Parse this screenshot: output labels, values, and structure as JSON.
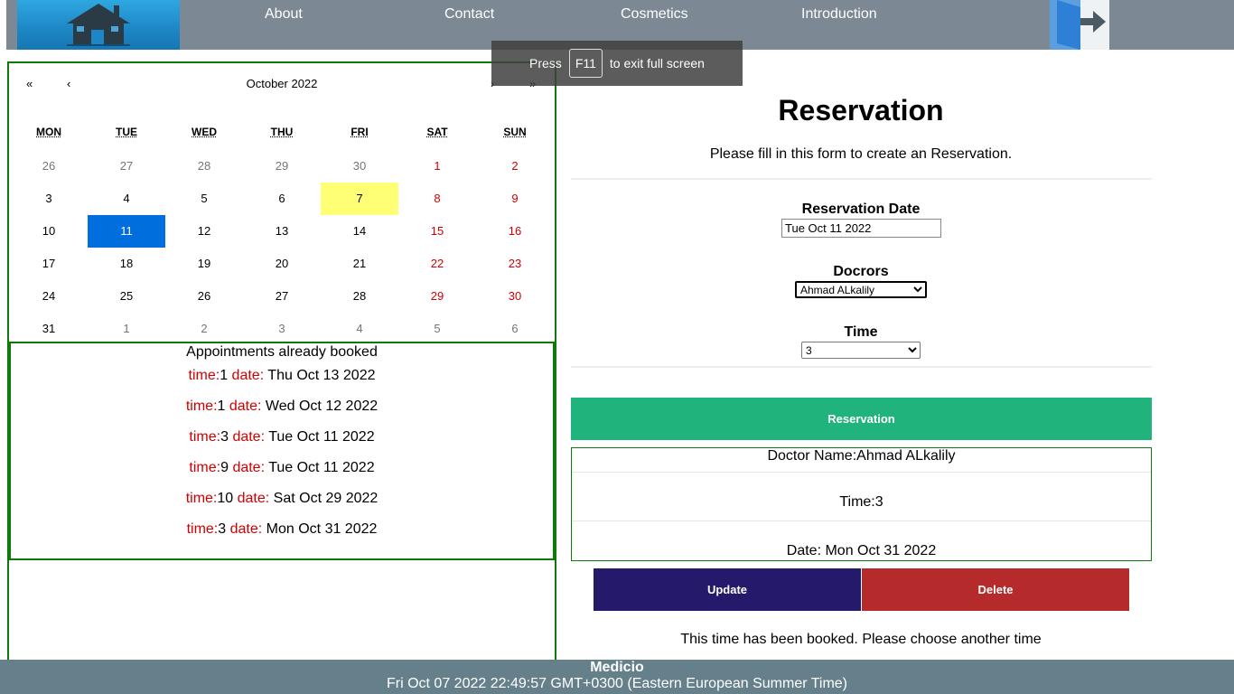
{
  "header": {
    "nav": [
      "About",
      "Contact",
      "Cosmetics",
      "Introduction"
    ]
  },
  "fullscreen_notice": {
    "press": "Press",
    "key": "F11",
    "rest": "to exit full screen"
  },
  "calendar": {
    "title": "October 2022",
    "nav_prev2": "«",
    "nav_prev": "‹",
    "nav_next": "›",
    "nav_next2": "»",
    "weekdays": [
      "MON",
      "TUE",
      "WED",
      "THU",
      "FRI",
      "SAT",
      "SUN"
    ],
    "days": [
      [
        "26",
        "27",
        "28",
        "29",
        "30",
        "1",
        "2"
      ],
      [
        "3",
        "4",
        "5",
        "6",
        "7",
        "8",
        "9"
      ],
      [
        "10",
        "11",
        "12",
        "13",
        "14",
        "15",
        "16"
      ],
      [
        "17",
        "18",
        "19",
        "20",
        "21",
        "22",
        "23"
      ],
      [
        "24",
        "25",
        "26",
        "27",
        "28",
        "29",
        "30"
      ],
      [
        "31",
        "1",
        "2",
        "3",
        "4",
        "5",
        "6"
      ]
    ],
    "today": "7",
    "selected": "11",
    "weekend_color": "#d10000",
    "selected_color": "#006edc",
    "today_color": "#ffff76"
  },
  "booked": {
    "title": "Appointments already booked",
    "time_label": "time:",
    "date_label": "date:",
    "items": [
      {
        "time": "1",
        "date": "Thu Oct 13 2022"
      },
      {
        "time": "1",
        "date": "Wed Oct 12 2022"
      },
      {
        "time": "3",
        "date": "Tue Oct 11 2022"
      },
      {
        "time": "9",
        "date": "Tue Oct 11 2022"
      },
      {
        "time": "10",
        "date": "Sat Oct 29 2022"
      },
      {
        "time": "3",
        "date": "Mon Oct 31 2022"
      }
    ]
  },
  "form": {
    "title": "Reservation",
    "subtitle": "Please fill in this form to create an Reservation.",
    "date_label": "Reservation Date",
    "date_value": "Tue Oct 11 2022",
    "doctors_label": "Docrors",
    "doctor_selected": "Ahmad ALkalily",
    "time_label": "Time",
    "time_selected": "3",
    "reserve_button": "Reservation"
  },
  "details": {
    "doctor": "Doctor Name:Ahmad ALkalily",
    "time": "Time:3",
    "date": "Date: Mon Oct 31 2022"
  },
  "actions": {
    "update": "Update",
    "delete": "Delete"
  },
  "message": "This time has been booked. Please choose another time",
  "footer": {
    "brand": "Medicio",
    "datetime": "Fri Oct 07 2022 22:49:57 GMT+0300 (Eastern European Summer Time)"
  },
  "colors": {
    "header": "#7c8893",
    "footer": "#65808b",
    "reserve": "#20b47c",
    "update": "#24196b",
    "delete": "#b52a2a",
    "border": "#0a7a0a"
  }
}
